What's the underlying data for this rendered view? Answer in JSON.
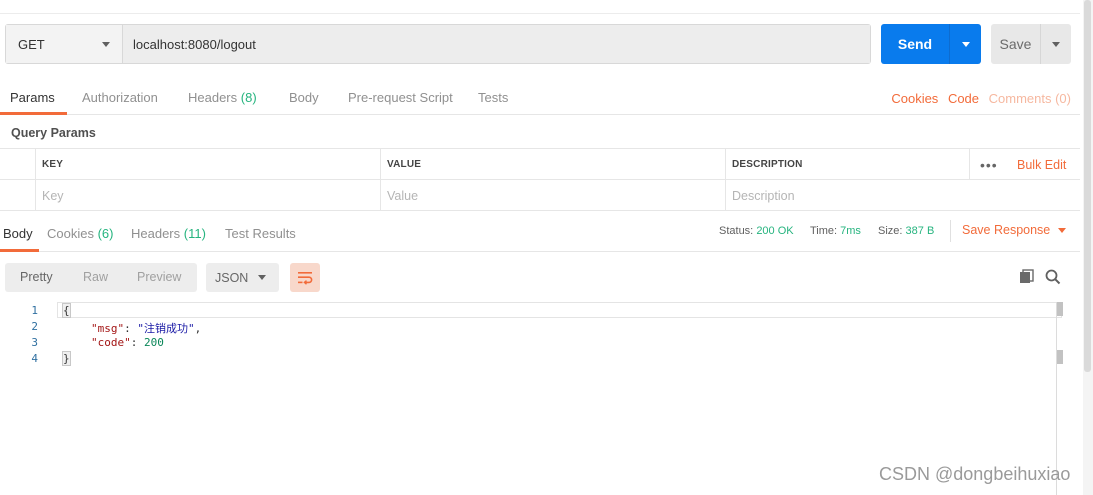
{
  "request": {
    "method": "GET",
    "url": "localhost:8080/logout",
    "send_label": "Send",
    "save_label": "Save"
  },
  "request_tabs": [
    {
      "label": "Params"
    },
    {
      "label": "Authorization"
    },
    {
      "label": "Headers",
      "count": "(8)"
    },
    {
      "label": "Body"
    },
    {
      "label": "Pre-request Script"
    },
    {
      "label": "Tests"
    }
  ],
  "request_links": {
    "cookies": "Cookies",
    "code": "Code",
    "comments": "Comments (0)"
  },
  "query_params": {
    "title": "Query Params",
    "columns": [
      "KEY",
      "VALUE",
      "DESCRIPTION"
    ],
    "placeholders": [
      "Key",
      "Value",
      "Description"
    ],
    "more": "•••",
    "bulk_edit": "Bulk Edit"
  },
  "response_tabs": [
    {
      "label": "Body"
    },
    {
      "label": "Cookies",
      "count": "(6)"
    },
    {
      "label": "Headers",
      "count": "(11)"
    },
    {
      "label": "Test Results"
    }
  ],
  "status": {
    "status_label": "Status:",
    "status_value": "200 OK",
    "time_label": "Time:",
    "time_value": "7ms",
    "size_label": "Size:",
    "size_value": "387 B",
    "save_response": "Save Response"
  },
  "view_modes": [
    "Pretty",
    "Raw",
    "Preview"
  ],
  "format": "JSON",
  "code": {
    "line_numbers": [
      "1",
      "2",
      "3",
      "4"
    ],
    "open_brace": "{",
    "close_brace": "}",
    "line2_key": "\"msg\"",
    "line2_value": "\"注销成功\"",
    "line3_key": "\"code\"",
    "line3_value": "200"
  },
  "watermark": "CSDN @dongbeihuxiao",
  "colors": {
    "accent": "#f26b3a",
    "send_blue": "#097bed",
    "success_green": "#26b47f"
  }
}
